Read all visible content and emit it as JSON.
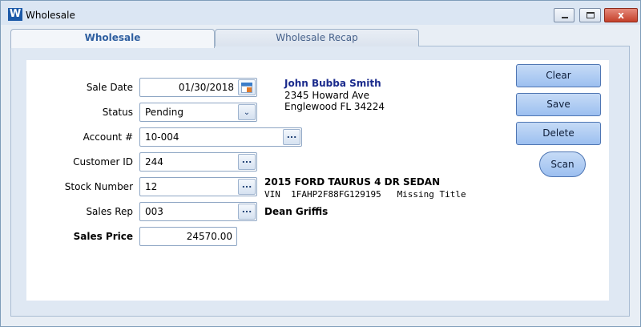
{
  "window": {
    "title": "Wholesale",
    "app_icon_letter": "W",
    "close_glyph": "x"
  },
  "tabs": [
    {
      "label": "Wholesale",
      "active": true
    },
    {
      "label": "Wholesale Recap",
      "active": false
    }
  ],
  "form": {
    "sale_date": {
      "label": "Sale Date",
      "value": "01/30/2018"
    },
    "status": {
      "label": "Status",
      "value": "Pending"
    },
    "account": {
      "label": "Account #",
      "value": "10-004"
    },
    "customer_id": {
      "label": "Customer ID",
      "value": "244"
    },
    "stock_number": {
      "label": "Stock Number",
      "value": "12"
    },
    "sales_rep": {
      "label": "Sales Rep",
      "value": "003"
    },
    "sales_price": {
      "label": "Sales Price",
      "value": "24570.00"
    }
  },
  "customer": {
    "name": "John Bubba Smith",
    "address1": "2345 Howard Ave",
    "address2": "Englewood FL 34224"
  },
  "vehicle": {
    "description": "2015 FORD TAURUS 4 DR SEDAN",
    "vin_line": "VIN  1FAHP2F88FG129195   Missing Title"
  },
  "rep_name": "Dean Griffis",
  "buttons": {
    "clear": "Clear",
    "save": "Save",
    "delete": "Delete",
    "scan": "Scan",
    "lookup_glyph": "...",
    "dropdown_glyph": "⌄"
  },
  "colors": {
    "customer_name": "#1a2a8c",
    "active_tab_text": "#2f5fa0",
    "button_fill": "#9cbff0"
  }
}
